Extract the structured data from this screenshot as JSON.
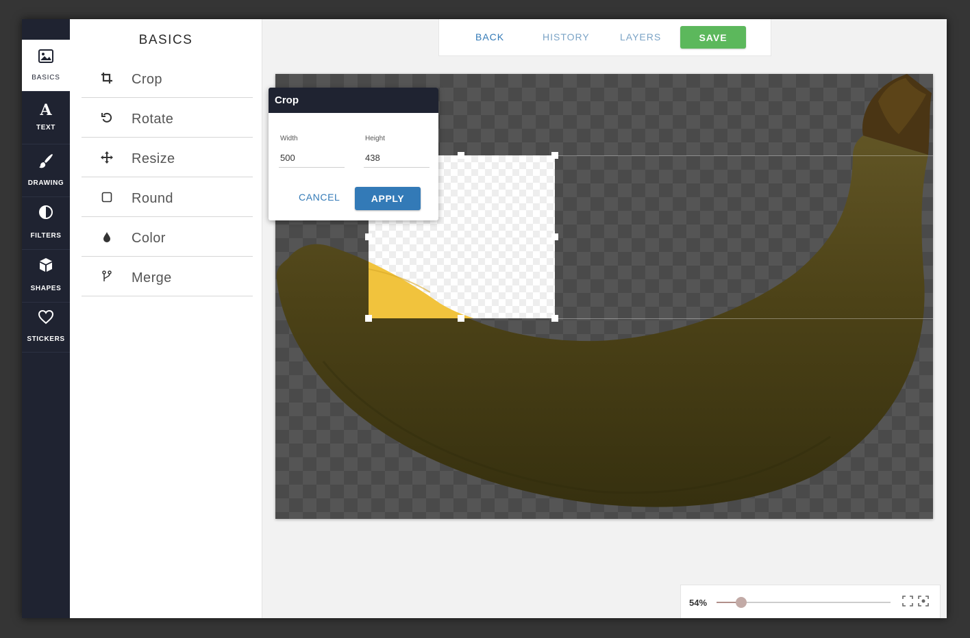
{
  "nav": {
    "items": [
      {
        "label": "BASICS",
        "icon": "image-icon",
        "active": true
      },
      {
        "label": "TEXT",
        "icon": "text-icon"
      },
      {
        "label": "DRAWING",
        "icon": "brush-icon"
      },
      {
        "label": "FILTERS",
        "icon": "contrast-icon"
      },
      {
        "label": "SHAPES",
        "icon": "cube-icon"
      },
      {
        "label": "STICKERS",
        "icon": "heart-icon"
      }
    ]
  },
  "panel": {
    "title": "BASICS",
    "tools": [
      {
        "label": "Crop",
        "icon": "crop-icon"
      },
      {
        "label": "Rotate",
        "icon": "rotate-icon"
      },
      {
        "label": "Resize",
        "icon": "move-icon"
      },
      {
        "label": "Round",
        "icon": "square-icon"
      },
      {
        "label": "Color",
        "icon": "drop-icon"
      },
      {
        "label": "Merge",
        "icon": "merge-icon"
      }
    ]
  },
  "toolbar": {
    "back": "BACK",
    "history": "HISTORY",
    "layers": "LAYERS",
    "save": "SAVE"
  },
  "crop_dialog": {
    "title": "Crop",
    "width_label": "Width",
    "width_value": "500",
    "height_label": "Height",
    "height_value": "438",
    "cancel": "CANCEL",
    "apply": "APPLY"
  },
  "zoom": {
    "label": "54%",
    "level": 0.14
  },
  "colors": {
    "sidebar": "#1f2331",
    "save": "#5cb85c",
    "apply": "#337ab7",
    "link": "#337ab7"
  }
}
